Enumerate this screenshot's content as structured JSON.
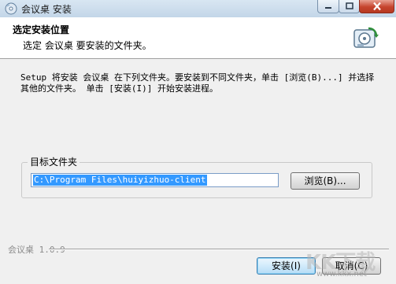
{
  "window": {
    "title": "会议桌 安装",
    "icon": "installer-disc-icon"
  },
  "header": {
    "title": "选定安装位置",
    "subtitle": "选定 会议桌 要安装的文件夹。",
    "icon": "installer-wizard-icon"
  },
  "main": {
    "description": "Setup 将安装 会议桌 在下列文件夹。要安装到不同文件夹，单击 [浏览(B)...] 并选择其他的文件夹。 单击 [安装(I)] 开始安装进程。",
    "group_label": "目标文件夹",
    "install_path": "C:\\Program Files\\huiyizhuo-client",
    "browse_label": "浏览(B)..."
  },
  "footer": {
    "brand": "会议桌 1.0.9",
    "install_label": "安装(I)",
    "cancel_label": "取消(C)"
  },
  "watermark": {
    "mark": "KK下载",
    "url": "www.kkx.net"
  },
  "colors": {
    "selection": "#3399ff",
    "close_button": "#c6442d",
    "header_bg": "#ffffff",
    "dialog_bg": "#f0f0f0"
  }
}
